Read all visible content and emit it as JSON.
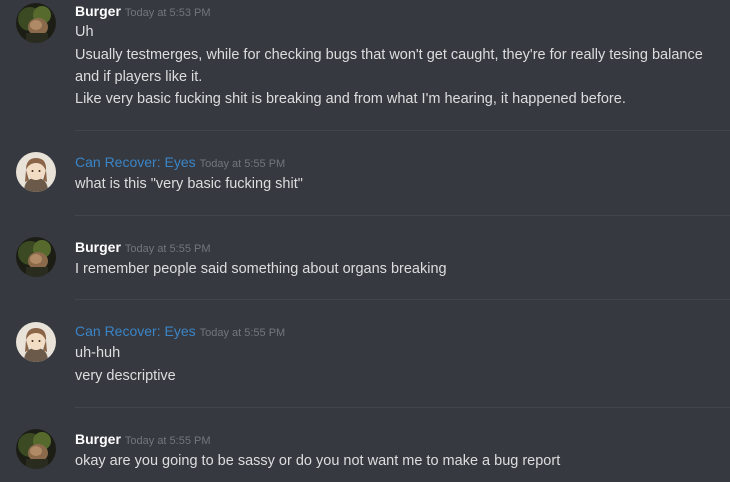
{
  "messages": [
    {
      "author": "Burger",
      "author_color": "#ffffff",
      "avatar": "burger-avatar-icon",
      "timestamp": "Today at 5:53 PM",
      "lines": [
        "Uh",
        "Usually testmerges, while for checking bugs that won't get caught, they're for really tesing balance",
        "and if players like it.",
        "Like very basic fucking shit is breaking and from what I'm hearing, it happened before."
      ]
    },
    {
      "author": "Can Recover: Eyes",
      "author_color": "#3a85c8",
      "avatar": "anime-character-avatar-icon",
      "timestamp": "Today at 5:55 PM",
      "lines": [
        "what is this \"very basic fucking shit\""
      ]
    },
    {
      "author": "Burger",
      "author_color": "#ffffff",
      "avatar": "burger-avatar-icon",
      "timestamp": "Today at 5:55 PM",
      "lines": [
        "I remember people said something about organs breaking"
      ]
    },
    {
      "author": "Can Recover: Eyes",
      "author_color": "#3a85c8",
      "avatar": "anime-character-avatar-icon",
      "timestamp": "Today at 5:55 PM",
      "lines": [
        "uh-huh",
        "very descriptive"
      ]
    },
    {
      "author": "Burger",
      "author_color": "#ffffff",
      "avatar": "burger-avatar-icon",
      "timestamp": "Today at 5:55 PM",
      "lines": [
        "okay are you going to be sassy or do you not want me to make a bug report"
      ]
    }
  ],
  "colors": {
    "background": "#36393f",
    "text": "#dcddde",
    "timestamp": "#72767d",
    "divider": "#42454a"
  }
}
